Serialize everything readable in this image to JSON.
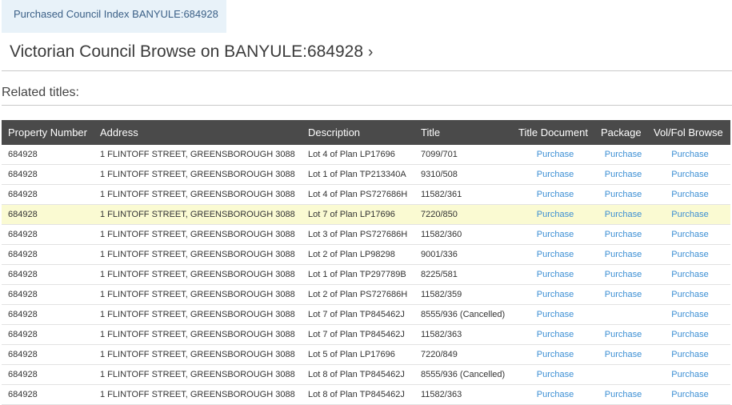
{
  "breadcrumb": {
    "label": "Purchased Council Index BANYULE:684928"
  },
  "page_title": {
    "text": "Victorian Council Browse on BANYULE:684928",
    "chevron": "›"
  },
  "related_heading": "Related titles:",
  "table": {
    "headers": [
      "Property Number",
      "Address",
      "Description",
      "Title",
      "Title Document",
      "Package",
      "Vol/Fol Browse"
    ],
    "rows": [
      {
        "property": "684928",
        "address": "1 FLINTOFF STREET, GREENSBOROUGH 3088",
        "description": "Lot 4 of Plan LP17696",
        "title": "7099/701",
        "title_document": "Purchase",
        "package": "Purchase",
        "volfol": "Purchase",
        "highlighted": false
      },
      {
        "property": "684928",
        "address": "1 FLINTOFF STREET, GREENSBOROUGH 3088",
        "description": "Lot 1 of Plan TP213340A",
        "title": "9310/508",
        "title_document": "Purchase",
        "package": "Purchase",
        "volfol": "Purchase",
        "highlighted": false
      },
      {
        "property": "684928",
        "address": "1 FLINTOFF STREET, GREENSBOROUGH 3088",
        "description": "Lot 4 of Plan PS727686H",
        "title": "11582/361",
        "title_document": "Purchase",
        "package": "Purchase",
        "volfol": "Purchase",
        "highlighted": false
      },
      {
        "property": "684928",
        "address": "1 FLINTOFF STREET, GREENSBOROUGH 3088",
        "description": "Lot 7 of Plan LP17696",
        "title": "7220/850",
        "title_document": "Purchase",
        "package": "Purchase",
        "volfol": "Purchase",
        "highlighted": true
      },
      {
        "property": "684928",
        "address": "1 FLINTOFF STREET, GREENSBOROUGH 3088",
        "description": "Lot 3 of Plan PS727686H",
        "title": "11582/360",
        "title_document": "Purchase",
        "package": "Purchase",
        "volfol": "Purchase",
        "highlighted": false
      },
      {
        "property": "684928",
        "address": "1 FLINTOFF STREET, GREENSBOROUGH 3088",
        "description": "Lot 2 of Plan LP98298",
        "title": "9001/336",
        "title_document": "Purchase",
        "package": "Purchase",
        "volfol": "Purchase",
        "highlighted": false
      },
      {
        "property": "684928",
        "address": "1 FLINTOFF STREET, GREENSBOROUGH 3088",
        "description": "Lot 1 of Plan TP297789B",
        "title": "8225/581",
        "title_document": "Purchase",
        "package": "Purchase",
        "volfol": "Purchase",
        "highlighted": false
      },
      {
        "property": "684928",
        "address": "1 FLINTOFF STREET, GREENSBOROUGH 3088",
        "description": "Lot 2 of Plan PS727686H",
        "title": "11582/359",
        "title_document": "Purchase",
        "package": "Purchase",
        "volfol": "Purchase",
        "highlighted": false
      },
      {
        "property": "684928",
        "address": "1 FLINTOFF STREET, GREENSBOROUGH 3088",
        "description": "Lot 7 of Plan TP845462J",
        "title": "8555/936 (Cancelled)",
        "title_document": "Purchase",
        "package": "",
        "volfol": "Purchase",
        "highlighted": false
      },
      {
        "property": "684928",
        "address": "1 FLINTOFF STREET, GREENSBOROUGH 3088",
        "description": "Lot 7 of Plan TP845462J",
        "title": "11582/363",
        "title_document": "Purchase",
        "package": "Purchase",
        "volfol": "Purchase",
        "highlighted": false
      },
      {
        "property": "684928",
        "address": "1 FLINTOFF STREET, GREENSBOROUGH 3088",
        "description": "Lot 5 of Plan LP17696",
        "title": "7220/849",
        "title_document": "Purchase",
        "package": "Purchase",
        "volfol": "Purchase",
        "highlighted": false
      },
      {
        "property": "684928",
        "address": "1 FLINTOFF STREET, GREENSBOROUGH 3088",
        "description": "Lot 8 of Plan TP845462J",
        "title": "8555/936 (Cancelled)",
        "title_document": "Purchase",
        "package": "",
        "volfol": "Purchase",
        "highlighted": false
      },
      {
        "property": "684928",
        "address": "1 FLINTOFF STREET, GREENSBOROUGH 3088",
        "description": "Lot 8 of Plan TP845462J",
        "title": "11582/363",
        "title_document": "Purchase",
        "package": "Purchase",
        "volfol": "Purchase",
        "highlighted": false
      }
    ]
  },
  "colors": {
    "header_bg": "#4a4a4a",
    "link": "#3c8fd4",
    "highlight_row": "#fafad2",
    "breadcrumb_bg": "#e8f2f9"
  }
}
